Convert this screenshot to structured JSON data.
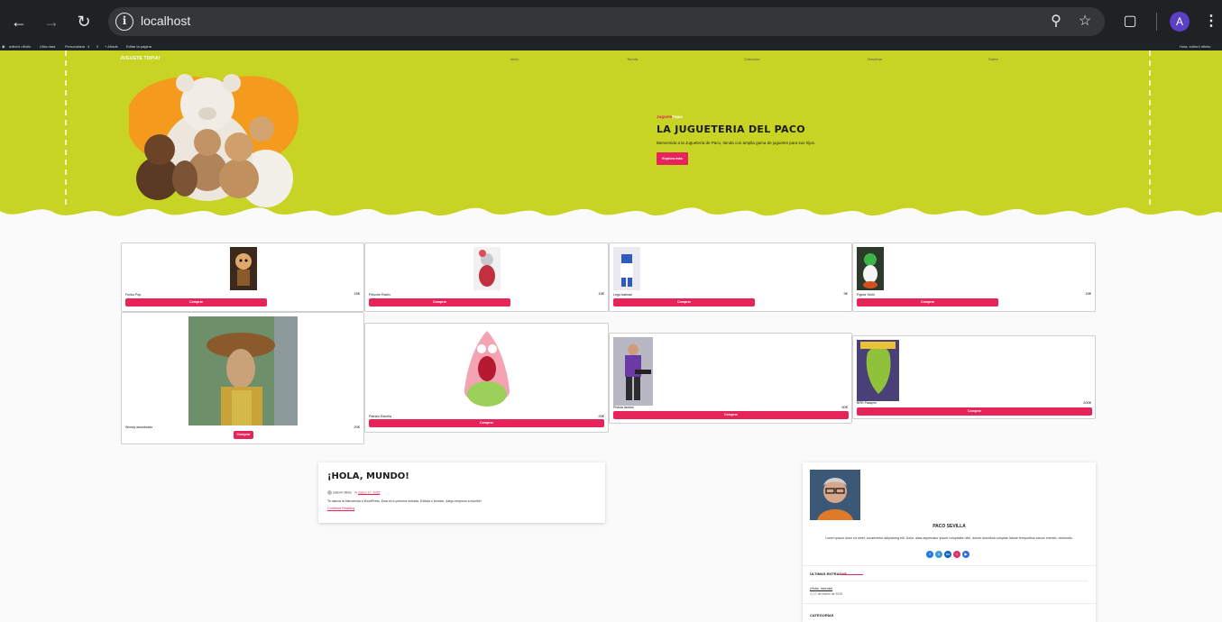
{
  "browser": {
    "url": "localhost",
    "avatar_letter": "A"
  },
  "adminbar": {
    "items": [
      "editor4 nfinito",
      "Ultra data",
      "Personalizar",
      "4",
      "0",
      "+ Añadir",
      "Editar la página"
    ],
    "right": "Hola, editor4 nfinito"
  },
  "site": {
    "logo": "JUGUETE TOPIA!",
    "nav": [
      "Inicio",
      "Tienda",
      "Colección",
      "Nosotros",
      "Sobre"
    ],
    "colors": {
      "hero_bg": "#c8d423",
      "accent": "#e6245a",
      "drip_bg": "#fafafa"
    }
  },
  "hero": {
    "eyebrow_a": "Juguete",
    "eyebrow_b": "Topia",
    "title": "LA JUGUETERIA DEL PACO",
    "text": "Bienvenido a la Juguetería de Paco, tienda con amplia gama de juguetes para sus hijos.",
    "button": "Explora más"
  },
  "products": [
    {
      "name": "Funko Pop",
      "price": "15€",
      "button": "Comprar"
    },
    {
      "name": "Peluche Ratón",
      "price": "15€",
      "button": "Comprar"
    },
    {
      "name": "Lego batman",
      "price": "5€",
      "button": "Comprar"
    },
    {
      "name": "Figura Yoshi",
      "price": "15€",
      "button": "Comprar"
    },
    {
      "name": "Woody asombrado",
      "price": "20€",
      "button": "Comprar"
    },
    {
      "name": "Patricio Estrella",
      "price": "20€",
      "button": "Comprar"
    },
    {
      "name": "Pistola dardos",
      "price": "50€",
      "button": "Comprar"
    },
    {
      "name": "BRR Patapim",
      "price": "200€",
      "button": "Comprar"
    }
  ],
  "post": {
    "title": "¡HOLA, MUNDO!",
    "author": "editor4 nfinito",
    "date": "marzo 17, 2025",
    "excerpt": "Te damos la bienvenida a WordPress. Esta es tu primera entrada. Edítala o bórrala, ¡luego empieza a escribir!",
    "more": "Continue Reading"
  },
  "sidebar": {
    "author_name": "PACO SEVILLA",
    "author_bio": "Lorem ipsum dolor sit amet, consectetur adipisicing elit. Dolor, alias aspernatur ipsum voluptates nihil, dolore doloribus voluptas labore temporibus earum eveniet, reiciendis.",
    "social_icons": [
      "facebook-icon",
      "twitter-icon",
      "linkedin-icon",
      "instagram-icon",
      "youtube-icon"
    ],
    "latest_title": "ÚLTIMAS ENTRADAS",
    "latest_post": "¡Hola, mundo!",
    "latest_date": "17 de marzo de 2025",
    "categories_title": "CATEGORÍAS"
  }
}
